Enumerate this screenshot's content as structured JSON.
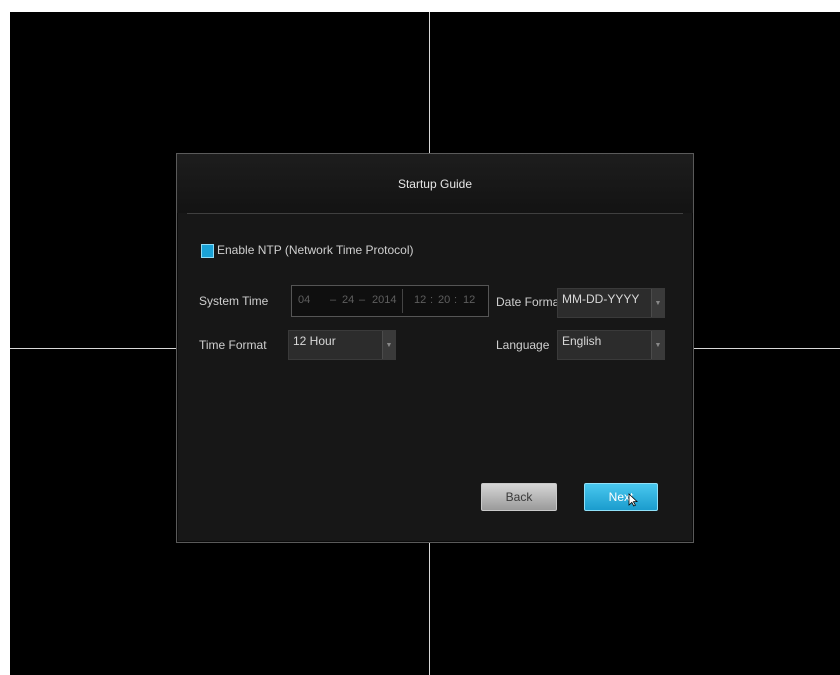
{
  "dialog": {
    "title": "Startup Guide",
    "ntp": {
      "label": "Enable NTP (Network Time Protocol)",
      "checked": true,
      "checkbox_color": "#1aa2d6"
    },
    "system_time": {
      "label": "System Time",
      "month": "04",
      "sep1": "–",
      "day": "24",
      "sep2": "–",
      "year": "2014",
      "hour": "12",
      "sep3": ":",
      "minute": "20",
      "sep4": ":",
      "second": "12"
    },
    "date_format": {
      "label": "Date Format",
      "value": "MM-DD-YYYY"
    },
    "time_format": {
      "label": "Time Format",
      "value": "12 Hour"
    },
    "language": {
      "label": "Language",
      "value": "English"
    },
    "buttons": {
      "back": "Back",
      "next": "Next"
    }
  },
  "colors": {
    "accent": "#1aa2d6",
    "next_button": "#2cb4e0"
  }
}
